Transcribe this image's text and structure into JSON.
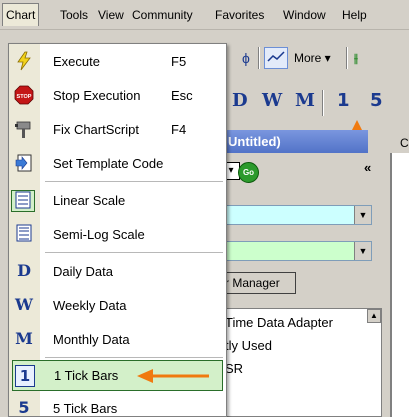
{
  "menubar": {
    "items": [
      {
        "label": "Chart",
        "active": true
      },
      {
        "label": "Tools"
      },
      {
        "label": "View"
      },
      {
        "label": "Community"
      },
      {
        "label": "Favorites"
      },
      {
        "label": "Window"
      },
      {
        "label": "Help"
      }
    ]
  },
  "toolbar": {
    "more_label": "More ▾"
  },
  "period_bar": {
    "items": [
      "D",
      "W",
      "M",
      "1",
      "5"
    ]
  },
  "child_window": {
    "title": "Untitled)",
    "c_label": "C",
    "go_label": "Go",
    "manager_button": "r Manager",
    "list_items": [
      "Time Data Adapter",
      "tly Used",
      "SR"
    ]
  },
  "chart_menu": {
    "items": [
      {
        "icon": "lightning-icon",
        "label": "Execute",
        "shortcut": "F5"
      },
      {
        "icon": "stop-icon",
        "label": "Stop Execution",
        "shortcut": "Esc",
        "icon_text": "STOP"
      },
      {
        "icon": "wrench-icon",
        "label": "Fix ChartScript",
        "shortcut": "F4"
      },
      {
        "icon": "template-icon",
        "label": "Set Template Code",
        "shortcut": ""
      },
      {
        "icon": "linear-scale-icon",
        "label": "Linear Scale",
        "shortcut": ""
      },
      {
        "icon": "semilog-scale-icon",
        "label": "Semi-Log Scale",
        "shortcut": ""
      },
      {
        "icon": "daily-icon",
        "label": "Daily Data",
        "shortcut": "",
        "icon_text": "D"
      },
      {
        "icon": "weekly-icon",
        "label": "Weekly Data",
        "shortcut": "",
        "icon_text": "W"
      },
      {
        "icon": "monthly-icon",
        "label": "Monthly Data",
        "shortcut": "",
        "icon_text": "M"
      },
      {
        "icon": "one-tick-icon",
        "label": "1 Tick Bars",
        "shortcut": "",
        "icon_text": "1",
        "highlighted": true
      },
      {
        "icon": "five-tick-icon",
        "label": "5 Tick Bars",
        "shortcut": "",
        "icon_text": "5"
      }
    ]
  },
  "colors": {
    "menu_highlight": "#d3f0c9",
    "annotation_arrow": "#f07a10",
    "title_bar": "#5273c8",
    "period_text": "#1b3a8f"
  }
}
